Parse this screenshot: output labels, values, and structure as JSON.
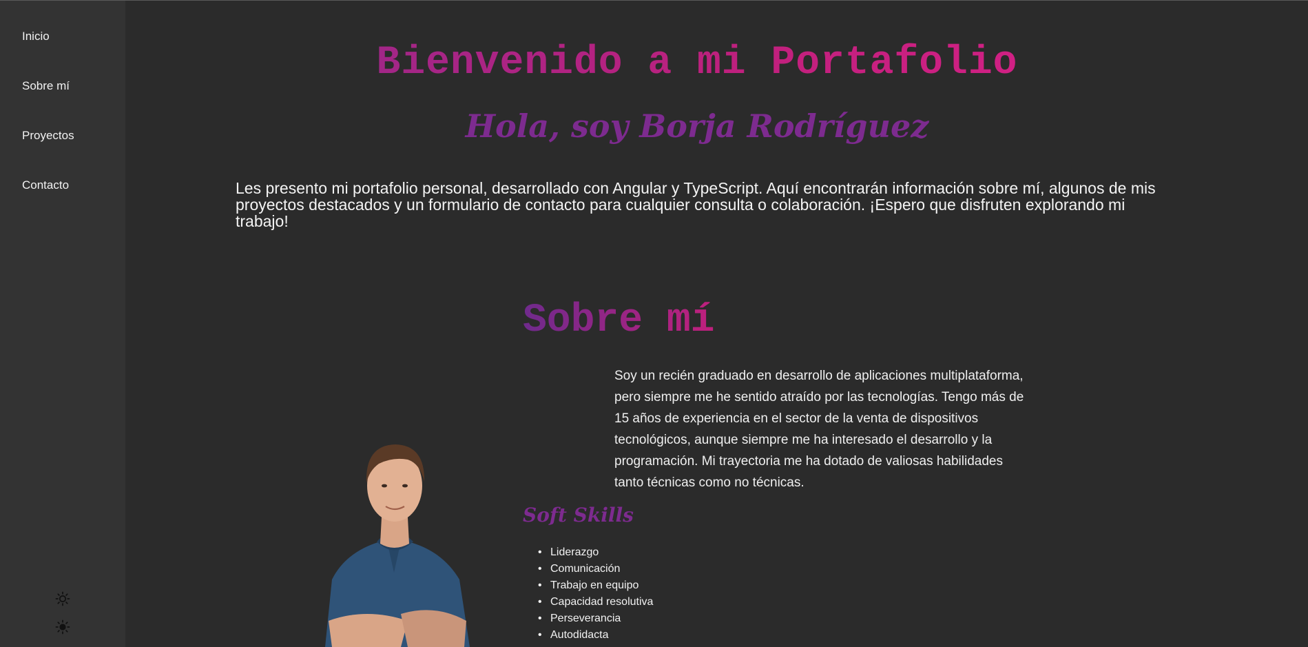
{
  "nav": {
    "items": [
      {
        "label": "Inicio"
      },
      {
        "label": "Sobre mí"
      },
      {
        "label": "Proyectos"
      },
      {
        "label": "Contacto"
      }
    ],
    "theme_icons": [
      "light-mode-icon",
      "dark-mode-icon"
    ]
  },
  "hero": {
    "title": "Bienvenido a mi Portafolio",
    "subtitle": "Hola, soy Borja Rodríguez",
    "intro": "Les presento mi portafolio personal, desarrollado con Angular y TypeScript. Aquí encontrarán información sobre mí, algunos de mis proyectos destacados y un formulario de contacto para cualquier consulta o colaboración. ¡Espero que disfruten explorando mi trabajo!"
  },
  "about": {
    "title": "Sobre mí",
    "text": "Soy un recién graduado en desarrollo de aplicaciones multiplataforma, pero siempre me he sentido atraído por las tecnologías. Tengo más de 15 años de experiencia en el sector de la venta de dispositivos tecnológicos, aunque siempre me ha interesado el desarrollo y la programación. Mi trayectoria me ha dotado de valiosas habilidades tanto técnicas como no técnicas.",
    "soft_skills_title": "Soft Skills",
    "soft_skills": [
      "Liderazgo",
      "Comunicación",
      "Trabajo en equipo",
      "Capacidad resolutiva",
      "Perseverancia",
      "Autodidacta"
    ]
  },
  "colors": {
    "background": "#2b2b2b",
    "sidebar": "#333333",
    "accent_pink": "#e0218a",
    "accent_purple": "#7d2b8f",
    "shirt_blue": "#2f5378"
  }
}
